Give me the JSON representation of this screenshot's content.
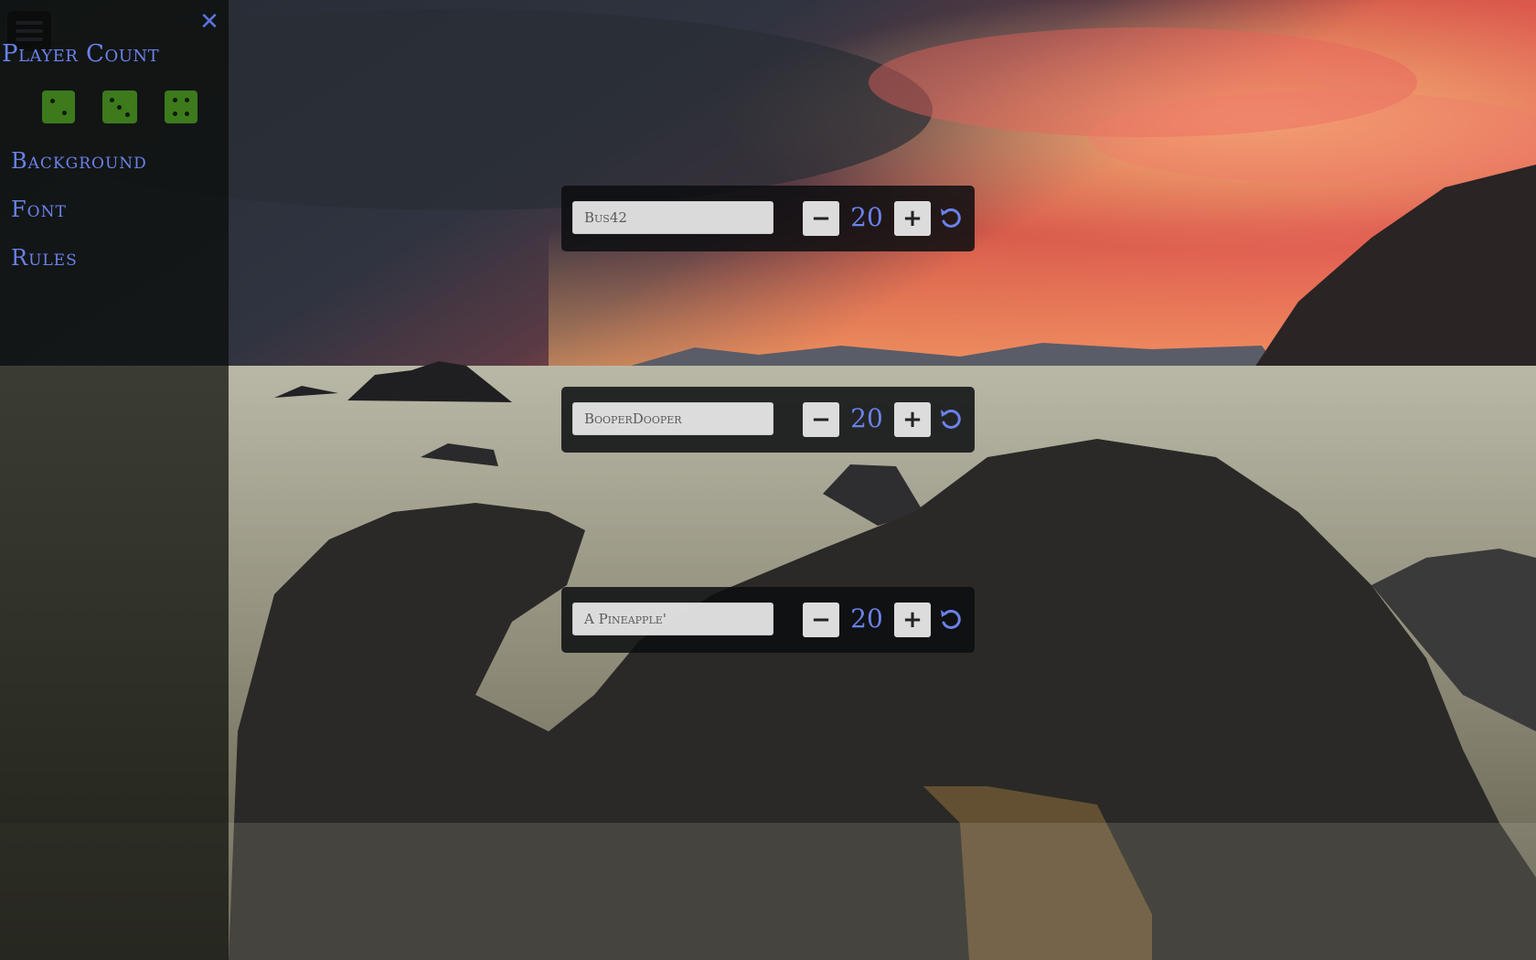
{
  "sidebar": {
    "title": "Player Count",
    "close_glyph": "✕",
    "dice": [
      {
        "name": "die-two",
        "pips": 2
      },
      {
        "name": "die-three",
        "pips": 3
      },
      {
        "name": "die-four",
        "pips": 4
      }
    ],
    "menu": [
      {
        "label": "Background"
      },
      {
        "label": "Font"
      },
      {
        "label": "Rules"
      }
    ]
  },
  "players": [
    {
      "name": "Bus42",
      "score": "20"
    },
    {
      "name": "BooperDooper",
      "score": "20"
    },
    {
      "name": "A Pineapple'",
      "score": "20"
    }
  ],
  "controls": {
    "minus_glyph": "−",
    "plus_glyph": "+"
  },
  "colors": {
    "accent": "#6a82ea",
    "die": "#3c7a1c",
    "panel": "#0c0e10"
  },
  "icons": {
    "menu": "hamburger-icon",
    "close": "close-icon",
    "reset": "reset-icon"
  }
}
